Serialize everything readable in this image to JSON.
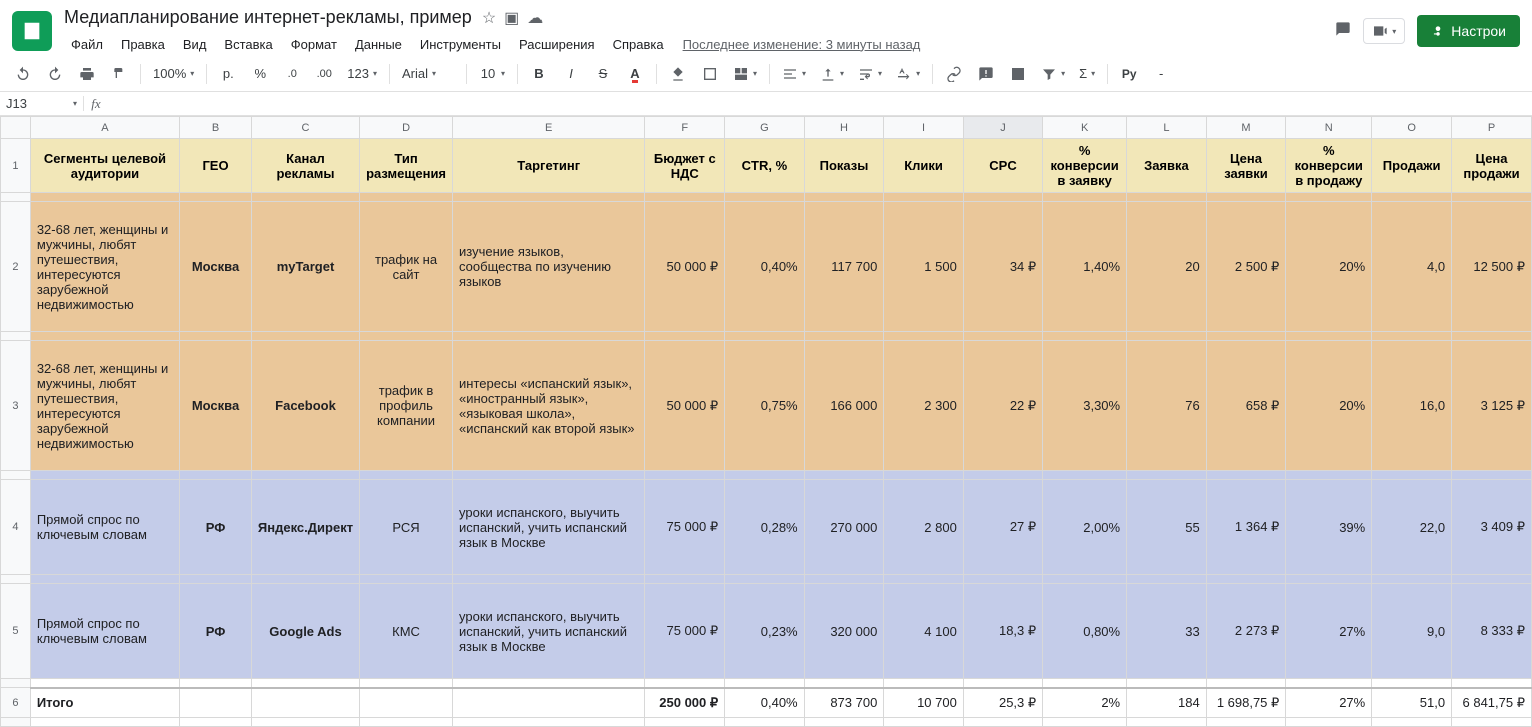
{
  "header": {
    "doc_title": "Медиапланирование интернет-рекламы, пример",
    "last_edit": "Последнее изменение: 3 минуты назад",
    "share_label": "Настрои"
  },
  "menus": [
    "Файл",
    "Правка",
    "Вид",
    "Вставка",
    "Формат",
    "Данные",
    "Инструменты",
    "Расширения",
    "Справка"
  ],
  "toolbar": {
    "zoom": "100%",
    "currency": "р.",
    "percent": "%",
    "dec_less": ".0",
    "dec_more": ".00",
    "numfmt": "123",
    "font": "Arial",
    "font_size": "10",
    "text_color": "A",
    "py": "Py",
    "dash": "-"
  },
  "namebox": {
    "ref": "J13",
    "formula": ""
  },
  "columns": [
    "A",
    "B",
    "C",
    "D",
    "E",
    "F",
    "G",
    "H",
    "I",
    "J",
    "K",
    "L",
    "M",
    "N",
    "O",
    "P"
  ],
  "selected_col": "J",
  "table": {
    "headers": [
      "Сегменты целевой аудитории",
      "ГЕО",
      "Канал рекламы",
      "Тип размещения",
      "Таргетинг",
      "Бюджет с НДС",
      "CTR, %",
      "Показы",
      "Клики",
      "CPC",
      "% конверсии в заявку",
      "Заявка",
      "Цена заявки",
      "% конверсии в продажу",
      "Продажи",
      "Цена продажи"
    ],
    "rows": [
      {
        "style": "orange",
        "cells": [
          "32-68 лет, женщины и мужчины, любят путешествия, интересуются зарубежной недвижимостью",
          "Москва",
          "myTarget",
          "трафик на сайт",
          "изучение языков, сообщества по изучению языков",
          "50 000 ₽",
          "0,40%",
          "117 700",
          "1 500",
          "34 ₽",
          "1,40%",
          "20",
          "2 500 ₽",
          "20%",
          "4,0",
          "12 500 ₽"
        ]
      },
      {
        "style": "orange",
        "cells": [
          "32-68 лет, женщины и мужчины, любят путешествия, интересуются зарубежной недвижимостью",
          "Москва",
          "Facebook",
          "трафик в профиль компании",
          "интересы «испанский язык», «иностранный язык», «языковая школа», «испанский как второй язык»",
          "50 000 ₽",
          "0,75%",
          "166 000",
          "2 300",
          "22 ₽",
          "3,30%",
          "76",
          "658 ₽",
          "20%",
          "16,0",
          "3 125 ₽"
        ]
      },
      {
        "style": "blue",
        "cells": [
          "Прямой спрос по ключевым словам",
          "РФ",
          "Яндекс.Директ",
          "РСЯ",
          "уроки испанского, выучить испанский, учить испанский язык в Москве",
          "75 000 ₽",
          "0,28%",
          "270 000",
          "2 800",
          "27 ₽",
          "2,00%",
          "55",
          "1 364 ₽",
          "39%",
          "22,0",
          "3 409 ₽"
        ]
      },
      {
        "style": "blue",
        "cells": [
          "Прямой спрос по ключевым словам",
          "РФ",
          "Google Ads",
          "КМС",
          "уроки испанского, выучить испанский, учить испанский язык в Москве",
          "75 000 ₽",
          "0,23%",
          "320 000",
          "4 100",
          "18,3 ₽",
          "0,80%",
          "33",
          "2 273 ₽",
          "27%",
          "9,0",
          "8 333 ₽"
        ]
      }
    ],
    "total": {
      "label": "Итого",
      "cells": [
        "",
        "",
        "",
        "",
        "250 000 ₽",
        "0,40%",
        "873 700",
        "10 700",
        "25,3 ₽",
        "2%",
        "184",
        "1 698,75 ₽",
        "27%",
        "51,0",
        "6 841,75 ₽"
      ]
    }
  }
}
